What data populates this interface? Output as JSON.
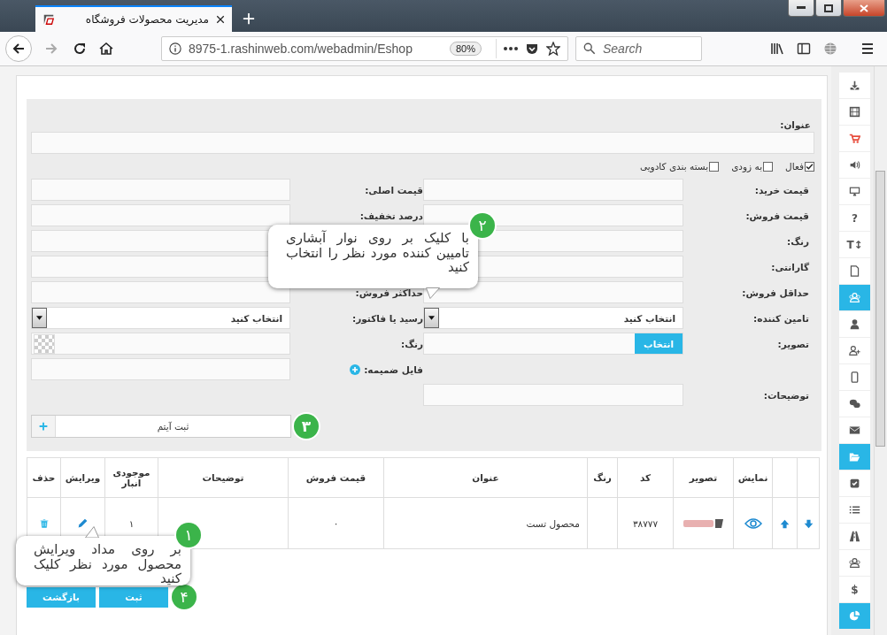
{
  "browser": {
    "tab_title": "مدیریت محصولات فروشگاه",
    "url": "8975-1.rashinweb.com/webadmin/Eshop",
    "zoom": "80%",
    "search_placeholder": "Search"
  },
  "form": {
    "title_label": "عنوان:",
    "checkboxes": [
      {
        "label": "فعال",
        "checked": true
      },
      {
        "label": "به زودی",
        "checked": false
      },
      {
        "label": "بسته بندی کادویی",
        "checked": false
      }
    ],
    "rows": [
      {
        "cells": [
          {
            "label": "قیمت خرید:",
            "field": {
              "kind": "text"
            }
          },
          {
            "label": "قیمت اصلی:",
            "field": {
              "kind": "text"
            }
          }
        ]
      },
      {
        "cells": [
          {
            "label": "قیمت فروش:",
            "field": {
              "kind": "text"
            }
          },
          {
            "label": "درصد تخفیف:",
            "field": {
              "kind": "text"
            }
          }
        ]
      },
      {
        "cells": [
          {
            "label": "رنگ:",
            "field": {
              "kind": "text"
            }
          },
          {
            "field": {
              "kind": "text"
            }
          }
        ]
      },
      {
        "cells": [
          {
            "label": "گارانتی:",
            "field": {
              "kind": "text"
            }
          },
          {
            "field": {
              "kind": "text"
            }
          }
        ]
      },
      {
        "cells": [
          {
            "label": "حداقل فروش:",
            "field": {
              "kind": "text"
            }
          },
          {
            "label": "حداکثر فروش:",
            "field": {
              "kind": "text"
            }
          }
        ]
      },
      {
        "cells": [
          {
            "label": "تامین کننده:",
            "field": {
              "kind": "select",
              "value": "انتخاب کنید"
            }
          },
          {
            "label": "رسید یا فاکتور:",
            "field": {
              "kind": "select",
              "value": "انتخاب کنید"
            }
          }
        ]
      },
      {
        "cells": [
          {
            "label": "تصویر:",
            "field": {
              "kind": "file",
              "button": "انتخاب"
            }
          },
          {
            "label": "رنگ:",
            "field": {
              "kind": "color"
            }
          }
        ]
      },
      {
        "cells": [
          {},
          {
            "label": "فایل ضمیمه:",
            "field": {
              "kind": "attachment"
            }
          }
        ]
      },
      {
        "cells": [
          {
            "label": "توضیحات:",
            "field": {
              "kind": "text"
            }
          },
          {}
        ]
      }
    ],
    "add_item": {
      "label": "ثبت آیتم",
      "badge": "۳"
    }
  },
  "table": {
    "columns": [
      "",
      "",
      "نمایش",
      "تصویر",
      "کد",
      "رنگ",
      "عنوان",
      "قیمت فروش",
      "توضیحات",
      "موجودی انبار",
      "ویرایش",
      "حذف"
    ],
    "rows": [
      {
        "code": "۳۸۷۷۷",
        "title": "محصول تست",
        "price": "۰",
        "stock": "۱"
      }
    ]
  },
  "actions": {
    "buttons": [
      "ثبت",
      "بازگشت"
    ],
    "badge": "۴"
  },
  "callouts": [
    {
      "badge": "۲",
      "text": "با کلیک بر روی نوار آبشاری تامیین کننده مورد نظر را انتخاب کنید"
    },
    {
      "badge": "۱",
      "text": "بر روی مداد ویرایش محصول مورد نظر کلیک کنید"
    }
  ],
  "sidebar": {
    "items": [
      {
        "selected": false
      },
      {
        "selected": false
      },
      {
        "selected": false
      },
      {
        "selected": false
      },
      {
        "selected": false
      },
      {
        "selected": false,
        "glyph": "?"
      },
      {
        "selected": false,
        "glyph": "T↕"
      },
      {
        "selected": false
      },
      {
        "selected": true
      },
      {
        "selected": false
      },
      {
        "selected": false
      },
      {
        "selected": false
      },
      {
        "selected": false
      },
      {
        "selected": false
      },
      {
        "selected": true
      },
      {
        "selected": false
      },
      {
        "selected": false
      },
      {
        "selected": false
      },
      {
        "selected": false
      },
      {
        "selected": false,
        "glyph": "$"
      },
      {
        "selected": true
      }
    ]
  }
}
